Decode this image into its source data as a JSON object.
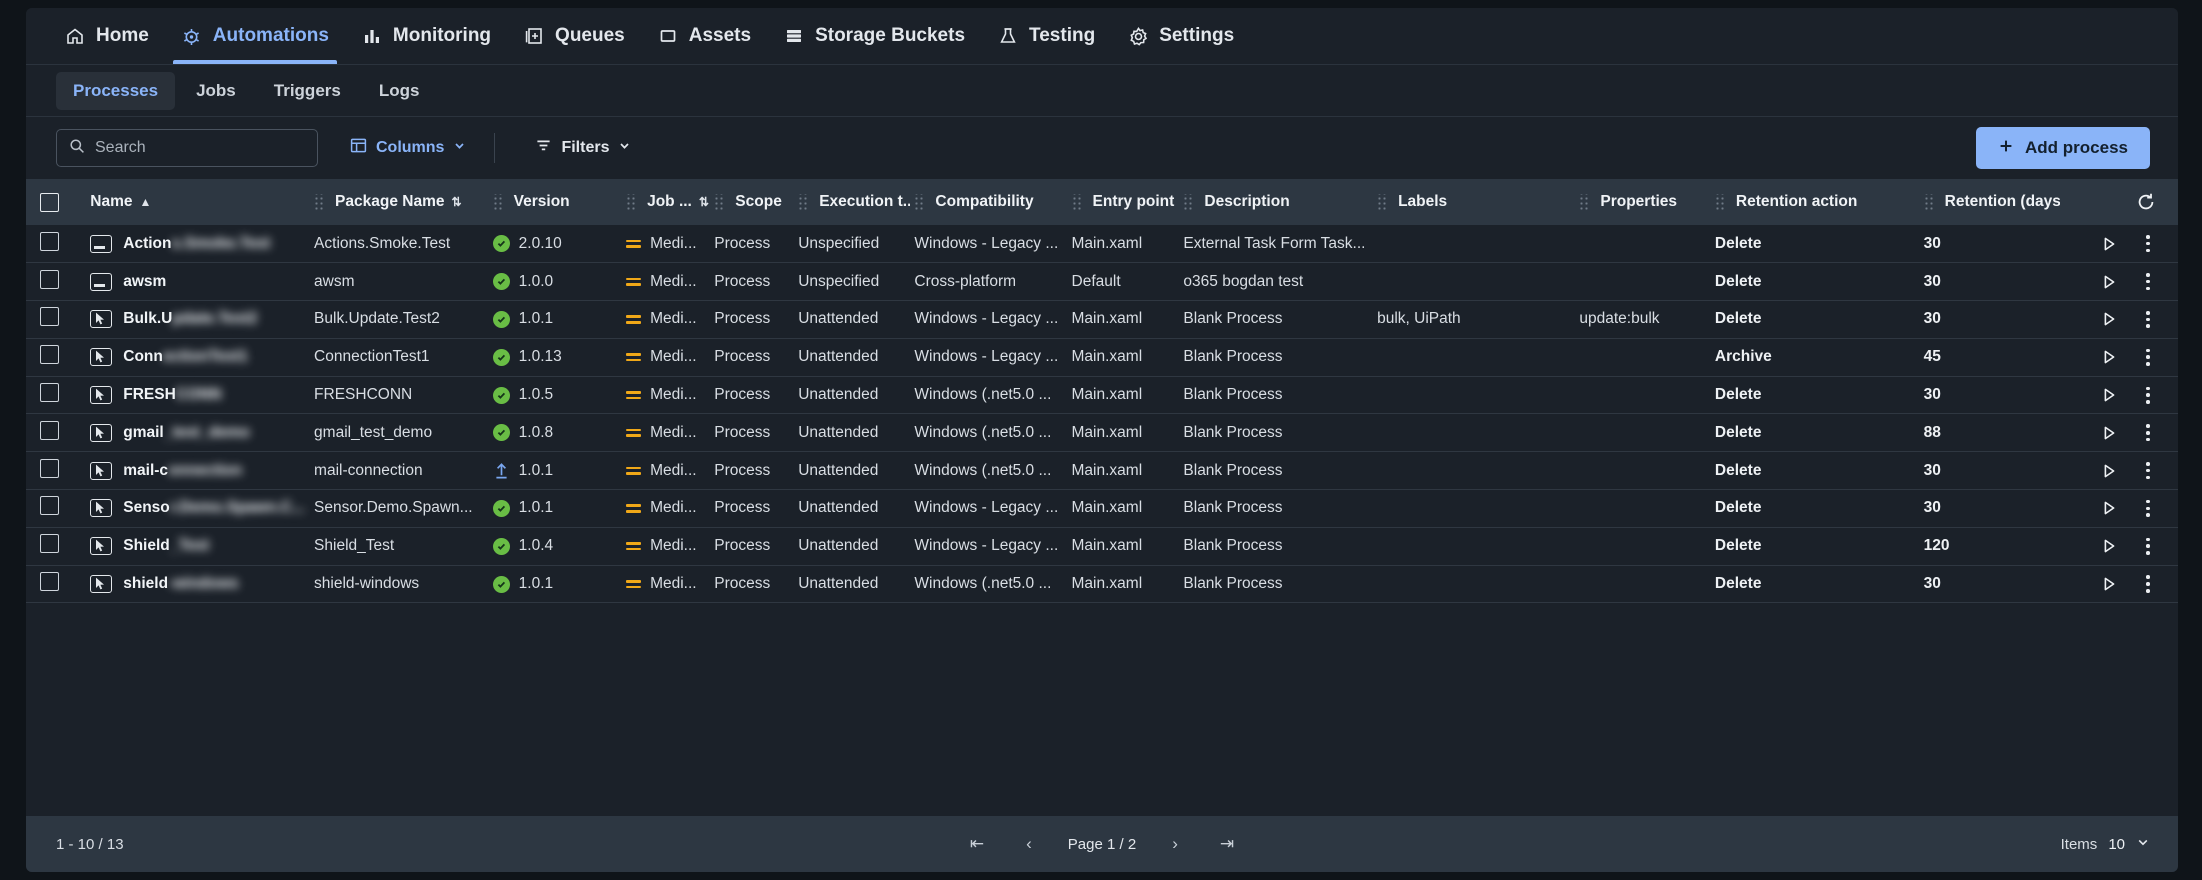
{
  "topnav": {
    "items": [
      {
        "label": "Home",
        "icon": "home-icon",
        "active": false
      },
      {
        "label": "Automations",
        "icon": "automations-icon",
        "active": true
      },
      {
        "label": "Monitoring",
        "icon": "monitoring-icon",
        "active": false
      },
      {
        "label": "Queues",
        "icon": "queues-icon",
        "active": false
      },
      {
        "label": "Assets",
        "icon": "assets-icon",
        "active": false
      },
      {
        "label": "Storage Buckets",
        "icon": "storage-buckets-icon",
        "active": false
      },
      {
        "label": "Testing",
        "icon": "testing-flask-icon",
        "active": false
      },
      {
        "label": "Settings",
        "icon": "gear-icon",
        "active": false
      }
    ]
  },
  "subtabs": {
    "items": [
      {
        "label": "Processes",
        "active": true
      },
      {
        "label": "Jobs",
        "active": false
      },
      {
        "label": "Triggers",
        "active": false
      },
      {
        "label": "Logs",
        "active": false
      }
    ]
  },
  "toolbar": {
    "search_placeholder": "Search",
    "search_value": "",
    "search_icon": "search-icon",
    "columns_label": "Columns",
    "columns_icon": "columns-icon",
    "filters_label": "Filters",
    "filters_icon": "filter-icon",
    "chevron_icon": "chevron-down-icon",
    "add_process_label": "Add process",
    "add_process_icon": "plus-icon",
    "accent_color": "#8ab4f8"
  },
  "table": {
    "refresh_icon": "refresh-icon",
    "columns": [
      {
        "key": "name",
        "label": "Name",
        "sort": "asc"
      },
      {
        "key": "package",
        "label": "Package Name",
        "sort": "both"
      },
      {
        "key": "version",
        "label": "Version",
        "sort": "none"
      },
      {
        "key": "jobpriority",
        "label": "Job ...",
        "sort": "both"
      },
      {
        "key": "scope",
        "label": "Scope",
        "sort": "none"
      },
      {
        "key": "exectype",
        "label": "Execution t...",
        "sort": "none"
      },
      {
        "key": "compat",
        "label": "Compatibility",
        "sort": "none"
      },
      {
        "key": "entry",
        "label": "Entry point",
        "sort": "none"
      },
      {
        "key": "description",
        "label": "Description",
        "sort": "none"
      },
      {
        "key": "labels",
        "label": "Labels",
        "sort": "none"
      },
      {
        "key": "properties",
        "label": "Properties",
        "sort": "none"
      },
      {
        "key": "retaction",
        "label": "Retention action",
        "sort": "none"
      },
      {
        "key": "retdays",
        "label": "Retention (days)",
        "sort": "both"
      }
    ],
    "rows": [
      {
        "name_visible": "Action",
        "name_blurred": "s.Smoke.Test",
        "name_icon": "screen-icon",
        "package": "Actions.Smoke.Test",
        "version": "2.0.10",
        "version_status": "ok",
        "jobpriority": "Medi...",
        "scope": "Process",
        "exectype": "Unspecified",
        "compat": "Windows - Legacy ...",
        "entry": "Main.xaml",
        "description": "External Task Form Task...",
        "labels": "",
        "properties": "",
        "retaction": "Delete",
        "retdays": "30"
      },
      {
        "name_visible": "awsm",
        "name_blurred": "",
        "name_icon": "screen-icon",
        "package": "awsm",
        "version": "1.0.0",
        "version_status": "ok",
        "jobpriority": "Medi...",
        "scope": "Process",
        "exectype": "Unspecified",
        "compat": "Cross-platform",
        "entry": "Default",
        "description": "o365 bogdan test",
        "labels": "",
        "properties": "",
        "retaction": "Delete",
        "retdays": "30"
      },
      {
        "name_visible": "Bulk.U",
        "name_blurred": "pdate.Test2",
        "name_icon": "cursor-icon",
        "package": "Bulk.Update.Test2",
        "version": "1.0.1",
        "version_status": "ok",
        "jobpriority": "Medi...",
        "scope": "Process",
        "exectype": "Unattended",
        "compat": "Windows - Legacy ...",
        "entry": "Main.xaml",
        "description": "Blank Process",
        "labels": "bulk, UiPath",
        "properties": "update:bulk",
        "retaction": "Delete",
        "retdays": "30"
      },
      {
        "name_visible": "Conn",
        "name_blurred": "ectionTest1",
        "name_icon": "cursor-icon",
        "package": "ConnectionTest1",
        "version": "1.0.13",
        "version_status": "ok",
        "jobpriority": "Medi...",
        "scope": "Process",
        "exectype": "Unattended",
        "compat": "Windows - Legacy ...",
        "entry": "Main.xaml",
        "description": "Blank Process",
        "labels": "",
        "properties": "",
        "retaction": "Archive",
        "retdays": "45"
      },
      {
        "name_visible": "FRESH",
        "name_blurred": "CONN",
        "name_icon": "cursor-icon",
        "package": "FRESHCONN",
        "version": "1.0.5",
        "version_status": "ok",
        "jobpriority": "Medi...",
        "scope": "Process",
        "exectype": "Unattended",
        "compat": "Windows (.net5.0 ...",
        "entry": "Main.xaml",
        "description": "Blank Process",
        "labels": "",
        "properties": "",
        "retaction": "Delete",
        "retdays": "30"
      },
      {
        "name_visible": "gmail",
        "name_blurred": "_test_demo",
        "name_icon": "cursor-icon",
        "package": "gmail_test_demo",
        "version": "1.0.8",
        "version_status": "ok",
        "jobpriority": "Medi...",
        "scope": "Process",
        "exectype": "Unattended",
        "compat": "Windows (.net5.0 ...",
        "entry": "Main.xaml",
        "description": "Blank Process",
        "labels": "",
        "properties": "",
        "retaction": "Delete",
        "retdays": "88"
      },
      {
        "name_visible": "mail-c",
        "name_blurred": "onnection",
        "name_icon": "cursor-icon",
        "package": "mail-connection",
        "version": "1.0.1",
        "version_status": "upgrade",
        "jobpriority": "Medi...",
        "scope": "Process",
        "exectype": "Unattended",
        "compat": "Windows (.net5.0 ...",
        "entry": "Main.xaml",
        "description": "Blank Process",
        "labels": "",
        "properties": "",
        "retaction": "Delete",
        "retdays": "30"
      },
      {
        "name_visible": "Senso",
        "name_blurred": "r.Demo.Spawn.C...",
        "name_icon": "cursor-icon",
        "package": "Sensor.Demo.Spawn...",
        "version": "1.0.1",
        "version_status": "ok",
        "jobpriority": "Medi...",
        "scope": "Process",
        "exectype": "Unattended",
        "compat": "Windows - Legacy ...",
        "entry": "Main.xaml",
        "description": "Blank Process",
        "labels": "",
        "properties": "",
        "retaction": "Delete",
        "retdays": "30"
      },
      {
        "name_visible": "Shield",
        "name_blurred": "_Test",
        "name_icon": "cursor-icon",
        "package": "Shield_Test",
        "version": "1.0.4",
        "version_status": "ok",
        "jobpriority": "Medi...",
        "scope": "Process",
        "exectype": "Unattended",
        "compat": "Windows - Legacy ...",
        "entry": "Main.xaml",
        "description": "Blank Process",
        "labels": "",
        "properties": "",
        "retaction": "Delete",
        "retdays": "120"
      },
      {
        "name_visible": "shield",
        "name_blurred": "-windows",
        "name_icon": "cursor-icon",
        "package": "shield-windows",
        "version": "1.0.1",
        "version_status": "ok",
        "jobpriority": "Medi...",
        "scope": "Process",
        "exectype": "Unattended",
        "compat": "Windows (.net5.0 ...",
        "entry": "Main.xaml",
        "description": "Blank Process",
        "labels": "",
        "properties": "",
        "retaction": "Delete",
        "retdays": "30"
      }
    ],
    "row_actions": {
      "run_icon": "play-icon",
      "more_icon": "kebab-menu-icon"
    }
  },
  "footer": {
    "range": "1 - 10 / 13",
    "first_icon": "first-page-icon",
    "prev_icon": "prev-page-icon",
    "page_label": "Page 1 / 2",
    "next_icon": "next-page-icon",
    "last_icon": "last-page-icon",
    "items_label": "Items",
    "items_value": "10",
    "items_chevron": "chevron-down-icon"
  }
}
